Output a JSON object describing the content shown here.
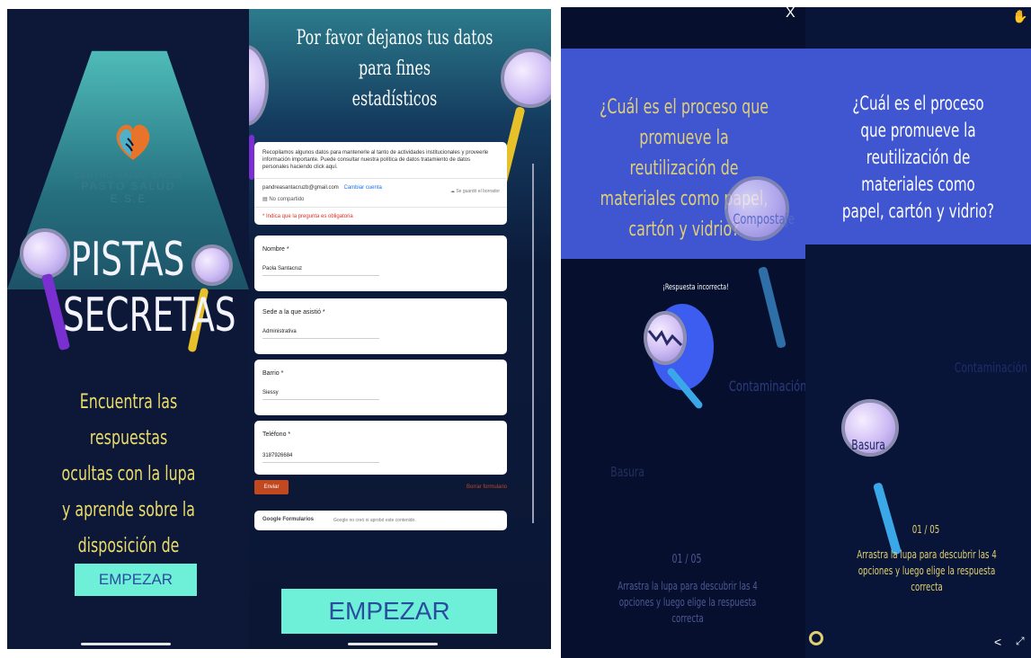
{
  "panel1": {
    "logo_text_top": "CENTRO SALUD SALUD",
    "logo_text": "PASTO SALUD E.S.E",
    "title_line1": "PISTAS",
    "title_line2": "SECRETAS",
    "desc_line1": "Encuentra las respuestas",
    "desc_line2": "ocultas con la lupa",
    "desc_line3": "y aprende sobre la",
    "desc_line4": "disposición de resíduos",
    "start_button": "EMPEZAR"
  },
  "panel2": {
    "heading_line1": "Por favor dejanos tus datos para fines",
    "heading_line2": "estadísticos",
    "form": {
      "intro": "Recopilamos algunos datos para mantenerle al tanto de actividades institucionales y proveerle información importante. Puede consultar nuestra política de datos tratamiento de datos personales haciendo click aquí.",
      "account_email": "pandreasantacruzb@gmail.com",
      "switch_account": "Cambiar cuenta",
      "not_shared": "No compartido",
      "saved_draft": "Se guardó el borrador",
      "required_note": "* Indica que la pregunta es obligatoria",
      "fields": [
        {
          "label": "Nombre *",
          "value": "Paola Santacruz"
        },
        {
          "label": "Sede a la que asistió *",
          "value": "Administrativa"
        },
        {
          "label": "Barrio *",
          "value": "Siessy"
        },
        {
          "label": "Teléfono *",
          "value": "3187926684"
        }
      ],
      "submit": "Enviar",
      "clear": "Borrar formulario",
      "footer_brand": "Google Formularios",
      "footer_note": "Google no creó ni aprobó este contenido."
    },
    "start_button": "EMPEZAR"
  },
  "panel3": {
    "close": "X",
    "question": "¿Cuál es el proceso que promueve la reutilización de materiales como papel, cartón y vidrio?",
    "option_compostaje": "Compostaje",
    "feedback": "¡Respuesta incorrecta!",
    "option_contaminacion": "Contaminación",
    "option_basura": "Basura",
    "counter": "01 / 05",
    "instruction": "Arrastra la lupa para descubrir las 4 opciones y luego elige la respuesta correcta"
  },
  "panel4": {
    "question": "¿Cuál es el proceso que promueve la reutilización de materiales como papel, cartón y vidrio?",
    "option_contaminacion": "Contaminación",
    "option_basura": "Basura",
    "counter": "01 / 05",
    "instruction": "Arrastra la lupa para descubrir las 4 opciones y luego elige la respuesta correcta"
  },
  "colors": {
    "accent_button": "#6ef0d8",
    "question_box": "#3f56d0",
    "title_yellow": "#e9dc6a"
  }
}
